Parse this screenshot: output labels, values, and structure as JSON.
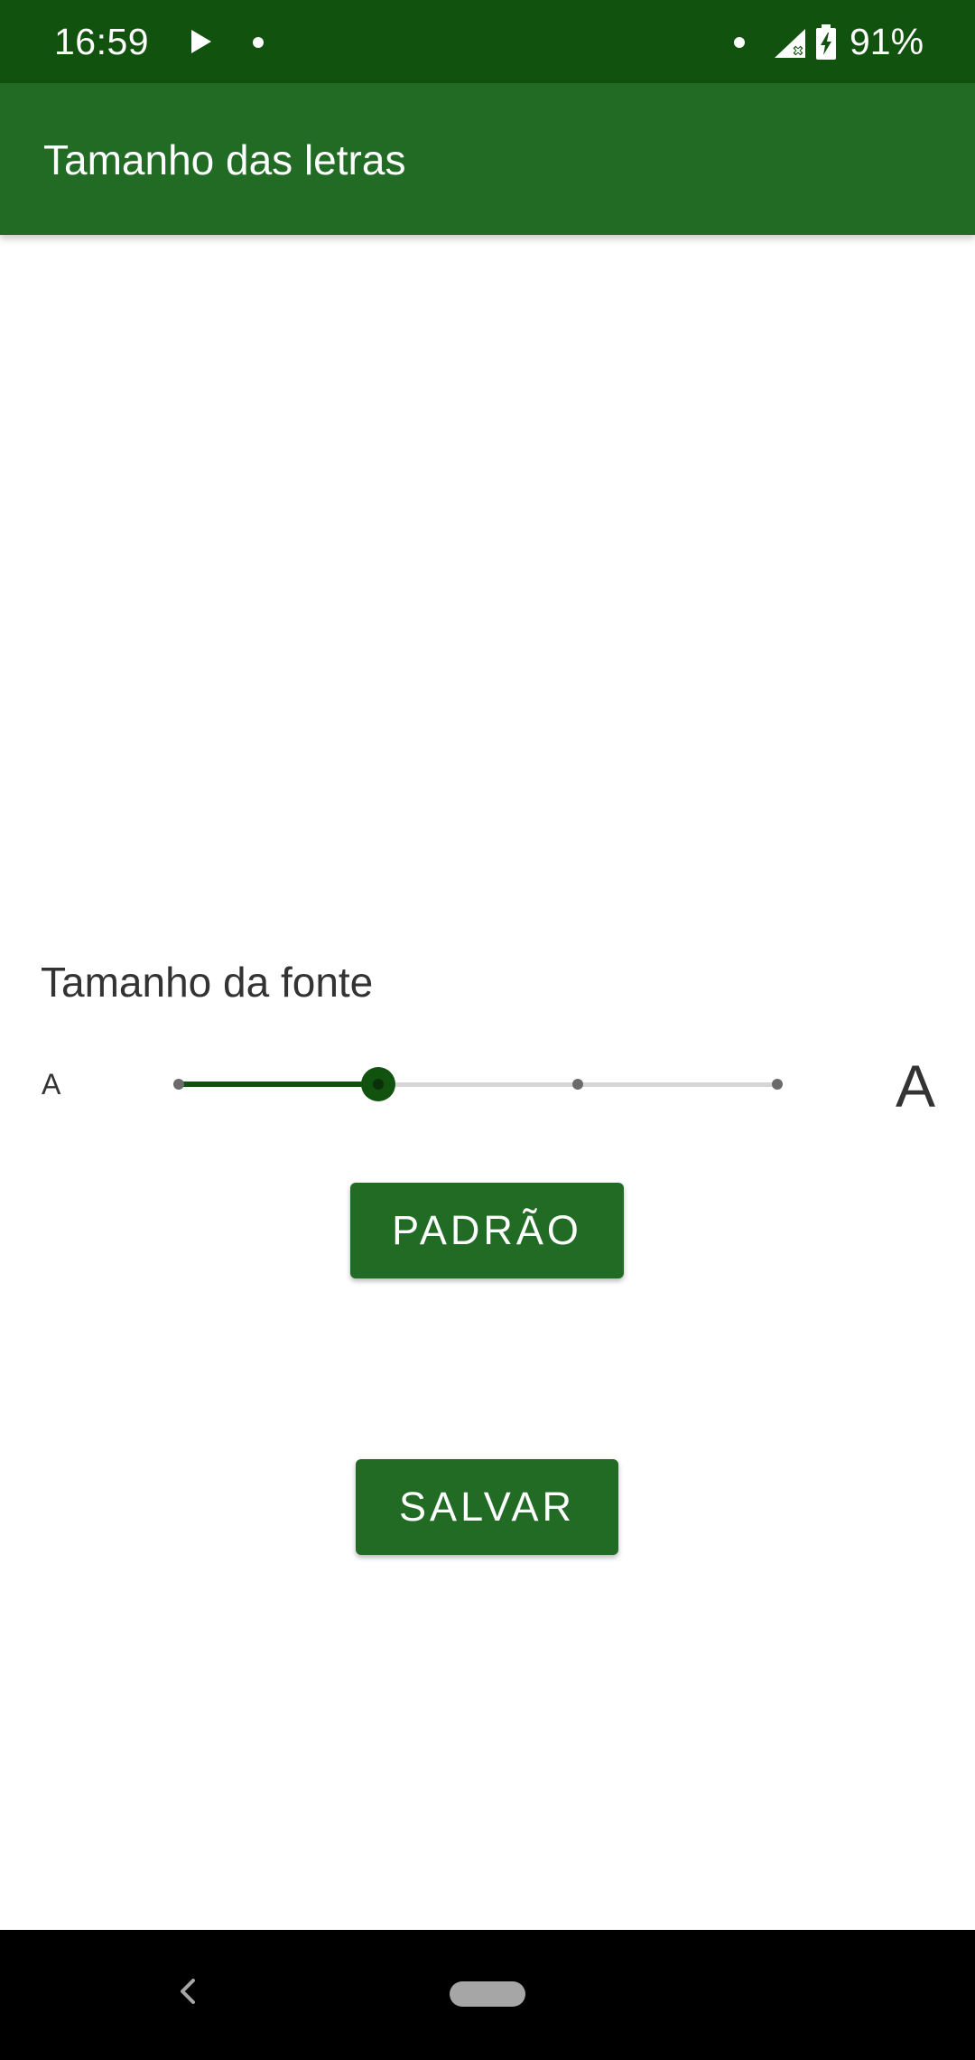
{
  "status_bar": {
    "time": "16:59",
    "battery": "91%",
    "icons": [
      "play-icon",
      "notification-dot-icon",
      "notification-dot-icon",
      "signal-icon",
      "battery-charging-icon"
    ]
  },
  "app_bar": {
    "title": "Tamanho das letras"
  },
  "font_size": {
    "label": "Tamanho da fonte",
    "small_glyph": "A",
    "large_glyph": "A",
    "slider": {
      "steps": 4,
      "selected_index": 1,
      "active_color": "#11520f",
      "track_color": "#d6d6d6"
    }
  },
  "buttons": {
    "default_label": "PADRÃO",
    "save_label": "SALVAR"
  },
  "colors": {
    "status_bar": "#11520f",
    "app_bar": "#216b25",
    "button": "#216b25"
  },
  "nav_bar": {
    "icons": [
      "back-icon",
      "home-pill-icon"
    ]
  }
}
